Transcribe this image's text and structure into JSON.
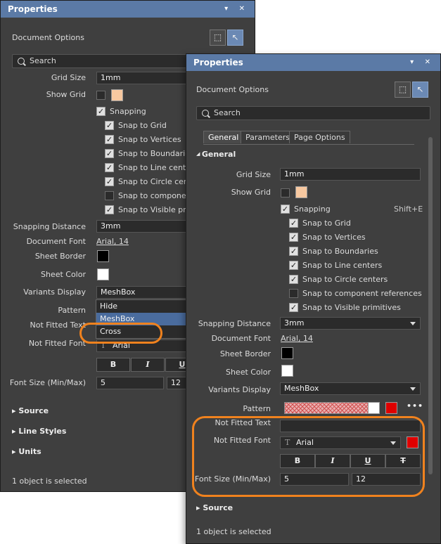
{
  "panel": {
    "title": "Properties",
    "controls": "▾ ✕",
    "document_options": "Document Options",
    "search_placeholder": "Search",
    "tabs": [
      "General",
      "Parameters",
      "Page Options"
    ],
    "group_title": "General",
    "labels": {
      "grid_size": "Grid Size",
      "show_grid": "Show Grid",
      "snapping": "Snapping",
      "snapping_shortcut": "Shift+E",
      "snapping_distance": "Snapping Distance",
      "document_font": "Document Font",
      "sheet_border": "Sheet Border",
      "sheet_color": "Sheet Color",
      "variants_display": "Variants Display",
      "pattern": "Pattern",
      "not_fitted_text": "Not Fitted Text",
      "not_fitted_font": "Not Fitted Font",
      "font_size": "Font Size (Min/Max)"
    },
    "snap_items": [
      "Snap to Grid",
      "Snap to Vertices",
      "Snap to Boundaries",
      "Snap to Line centers",
      "Snap to Circle centers",
      "Snap to component references",
      "Snap to Visible primitives"
    ],
    "values": {
      "grid_size": "1mm",
      "snapping_distance": "3mm",
      "document_font": "Arial, 14",
      "variants_display": "MeshBox",
      "not_fitted_font": "Arial",
      "font_size_min": "5",
      "font_size_max": "12"
    },
    "format_buttons": [
      "B",
      "I",
      "U",
      "T"
    ],
    "variants_options": [
      "Hide",
      "MeshBox",
      "Cross"
    ],
    "sections": [
      "Source",
      "Line Styles",
      "Units"
    ],
    "status": "1 object is selected"
  },
  "colors": {
    "title_bar": "#5b7aa6",
    "panel_bg": "#3f3f3f",
    "grid_color": "#f7c8a0",
    "sheet_border": "#000000",
    "sheet_color": "#ffffff",
    "font_color": "#e00000",
    "highlight": "#f0821e"
  },
  "icons": [
    "select-filter-icon",
    "select-cursor-icon",
    "search-icon",
    "font-icon",
    "more-icon"
  ]
}
